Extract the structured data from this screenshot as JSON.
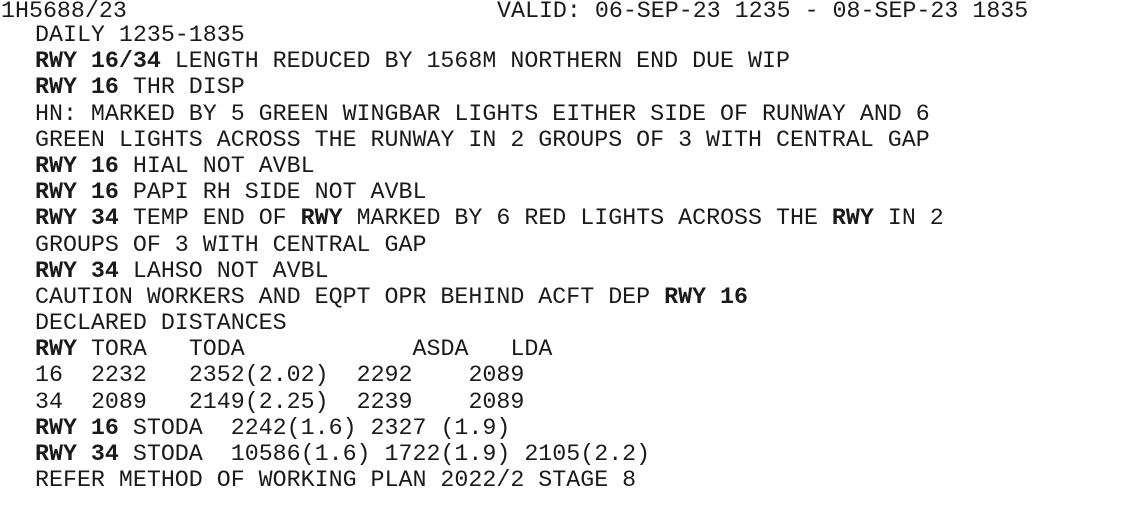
{
  "notam": {
    "id": "1H5688/23",
    "validity": "VALID: 06-SEP-23 1235 - 08-SEP-23 1835",
    "schedule": "DAILY 1235-1835",
    "lines": [
      {
        "bold_prefix": "RWY 16/34",
        "text": " LENGTH REDUCED BY 1568M NORTHERN END DUE WIP"
      },
      {
        "bold_prefix": "RWY 16",
        "text": " THR DISP"
      },
      {
        "bold_prefix": "",
        "text": "HN: MARKED BY 5 GREEN WINGBAR LIGHTS EITHER SIDE OF RUNWAY AND 6"
      },
      {
        "bold_prefix": "",
        "text": "GREEN LIGHTS ACROSS THE RUNWAY IN 2 GROUPS OF 3 WITH CENTRAL GAP"
      },
      {
        "bold_prefix": "RWY 16",
        "text": " HIAL NOT AVBL"
      },
      {
        "bold_prefix": "RWY 16",
        "text": " PAPI RH SIDE NOT AVBL"
      }
    ],
    "rwy34_temp_end": {
      "p1_bold": "RWY 34",
      "p2": " TEMP END OF ",
      "p3_bold": "RWY",
      "p4": " MARKED BY 6 RED LIGHTS ACROSS THE ",
      "p5_bold": "RWY",
      "p6": " IN 2",
      "continuation": "GROUPS OF 3 WITH CENTRAL GAP"
    },
    "lahso": {
      "bold_prefix": "RWY 34",
      "text": " LAHSO NOT AVBL"
    },
    "caution": {
      "text": "CAUTION WORKERS AND EQPT OPR BEHIND ACFT DEP ",
      "bold_suffix": "RWY 16"
    },
    "declared_distances": {
      "title": "DECLARED DISTANCES",
      "headers": [
        "RWY",
        "TORA",
        "TODA",
        "ASDA",
        "LDA"
      ],
      "rows": [
        [
          "16",
          "2232",
          "2352(2.02)",
          "2292",
          "2089"
        ],
        [
          "34",
          "2089",
          "2149(2.25)",
          "2239",
          "2089"
        ]
      ]
    },
    "stoda": [
      {
        "bold_prefix": "RWY 16",
        "text": " STODA  2242(1.6) 2327 (1.9)"
      },
      {
        "bold_prefix": "RWY 34",
        "text": " STODA  10586(1.6) 1722(1.9) 2105(2.2)"
      }
    ],
    "footer": "REFER METHOD OF WORKING PLAN 2022/2 STAGE 8"
  }
}
